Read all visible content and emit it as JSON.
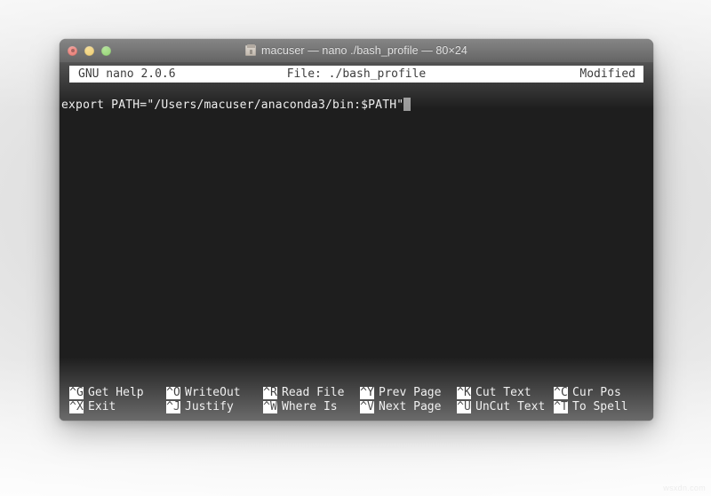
{
  "window": {
    "title": "macuser — nano ./bash_profile — 80×24",
    "icon": "terminal-folder-icon",
    "controls": {
      "close": "close-button",
      "minimize": "minimize-button",
      "zoom": "zoom-button"
    },
    "colors": {
      "titlebar": "#3c3c3c",
      "terminal_bg": "#1e1e1e",
      "terminal_fg": "#e8e8e8",
      "inverted_bg": "#ffffff",
      "inverted_fg": "#101010",
      "close": "#e05348",
      "minimize": "#e8bd47",
      "zoom": "#74c64a"
    }
  },
  "nano": {
    "header": {
      "version": "GNU nano 2.0.6",
      "file": "File: ./bash_profile",
      "status": "Modified"
    },
    "content": {
      "line1": "export PATH=\"/Users/macuser/anaconda3/bin:$PATH\"",
      "cursor": "block-cursor"
    },
    "shortcuts": {
      "row1": [
        {
          "key": "^G",
          "label": "Get Help"
        },
        {
          "key": "^O",
          "label": "WriteOut"
        },
        {
          "key": "^R",
          "label": "Read File"
        },
        {
          "key": "^Y",
          "label": "Prev Page"
        },
        {
          "key": "^K",
          "label": "Cut Text"
        },
        {
          "key": "^C",
          "label": "Cur Pos"
        }
      ],
      "row2": [
        {
          "key": "^X",
          "label": "Exit"
        },
        {
          "key": "^J",
          "label": "Justify"
        },
        {
          "key": "^W",
          "label": "Where Is"
        },
        {
          "key": "^V",
          "label": "Next Page"
        },
        {
          "key": "^U",
          "label": "UnCut Text"
        },
        {
          "key": "^T",
          "label": "To Spell"
        }
      ]
    }
  },
  "watermark": {
    "text": "wsxdn.com"
  }
}
